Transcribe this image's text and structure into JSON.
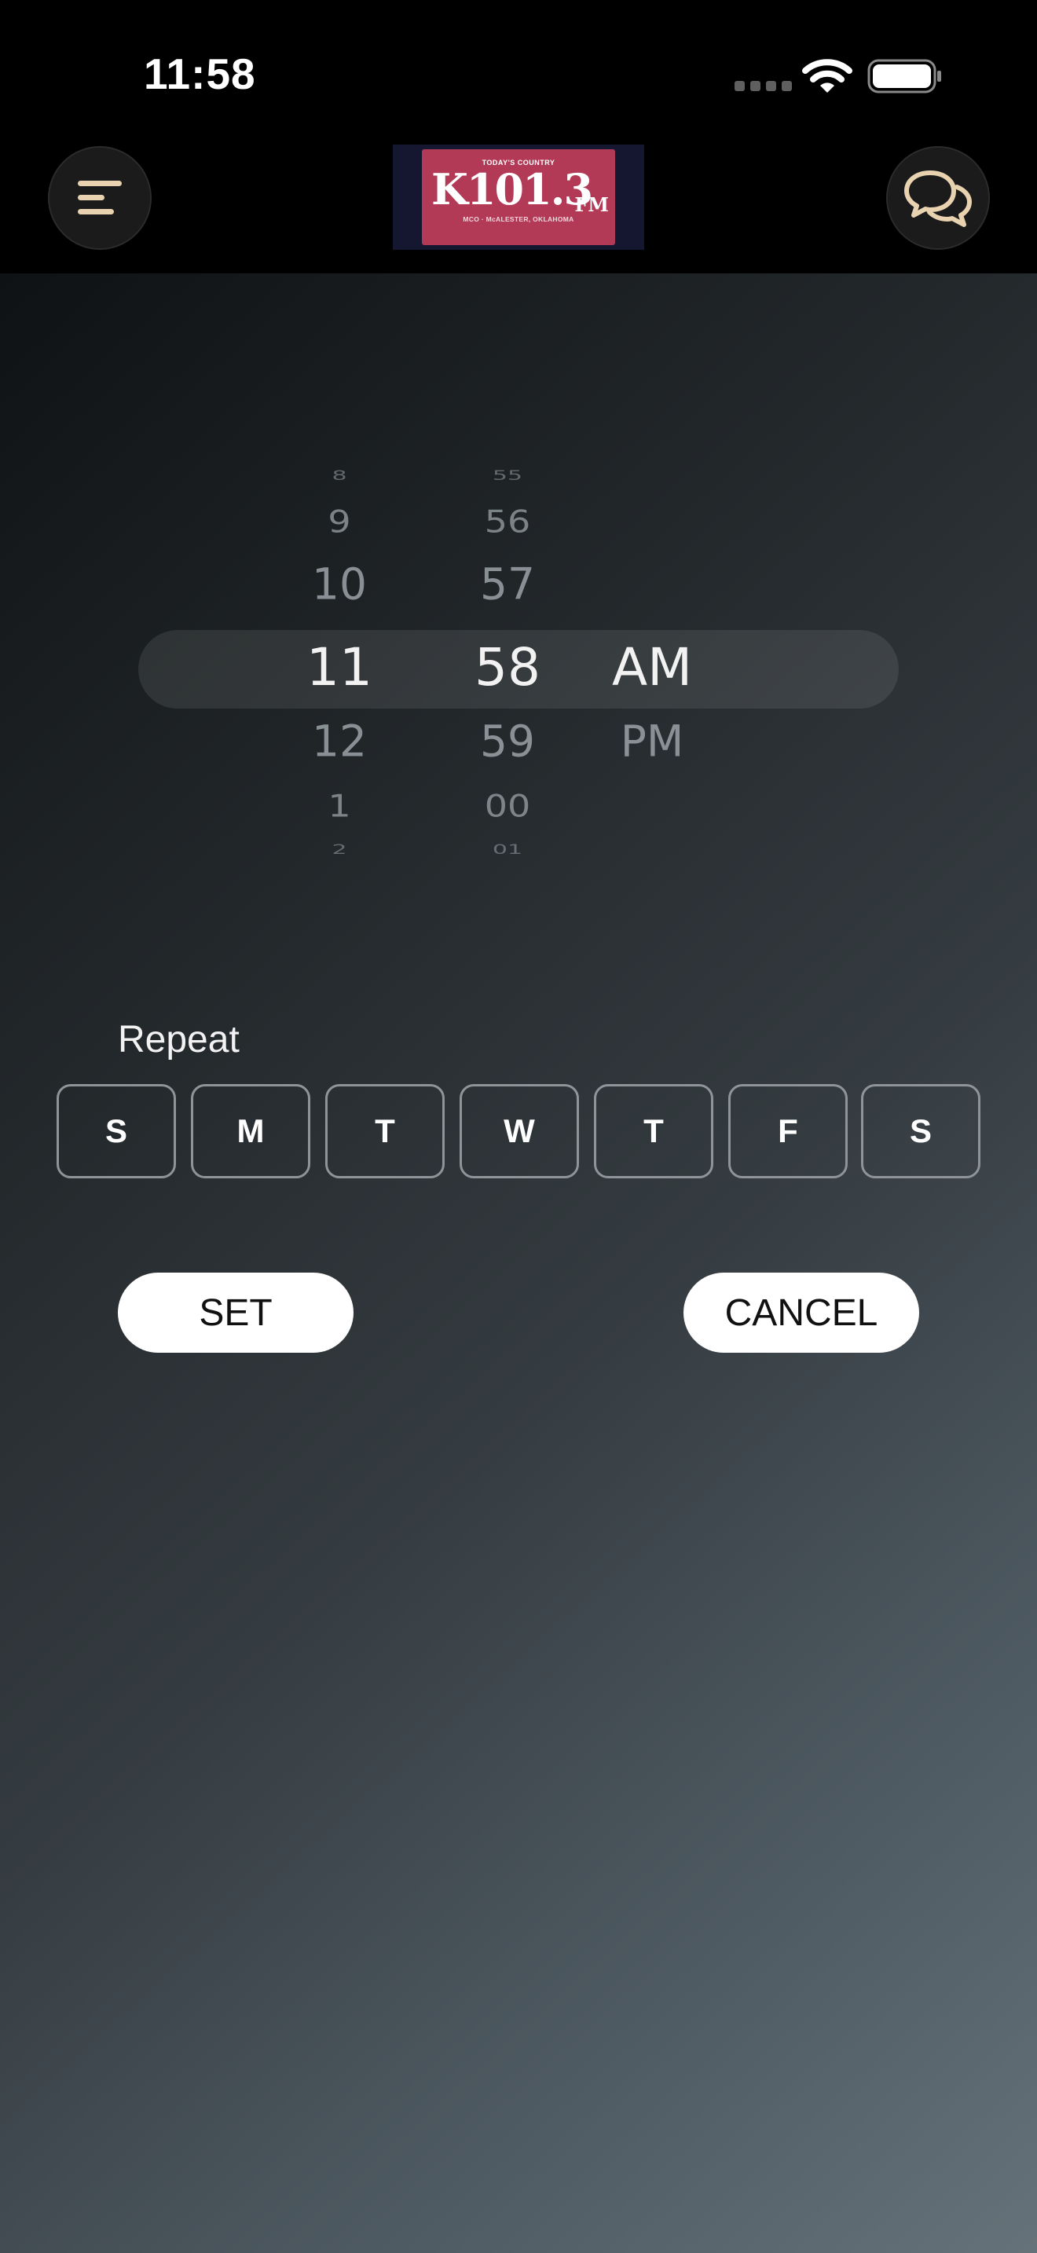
{
  "status_bar": {
    "time": "11:58"
  },
  "header": {
    "logo": {
      "tagline": "TODAY'S COUNTRY",
      "main": "K101.3",
      "fm": "FM",
      "location": "MCO · McALESTER, OKLAHOMA"
    },
    "menu_icon": "menu-lines-icon",
    "chat_icon": "chat-bubbles-icon",
    "accent_color": "#e8d2b0"
  },
  "time_picker": {
    "hours": [
      "8",
      "9",
      "10",
      "11",
      "12",
      "1",
      "2"
    ],
    "minutes": [
      "55",
      "56",
      "57",
      "58",
      "59",
      "00",
      "01"
    ],
    "periods": [
      "AM",
      "PM"
    ],
    "selected": {
      "hour": "11",
      "minute": "58",
      "period": "AM"
    }
  },
  "repeat": {
    "label": "Repeat",
    "days": [
      "S",
      "M",
      "T",
      "W",
      "T",
      "F",
      "S"
    ]
  },
  "buttons": {
    "set": "SET",
    "cancel": "CANCEL"
  }
}
